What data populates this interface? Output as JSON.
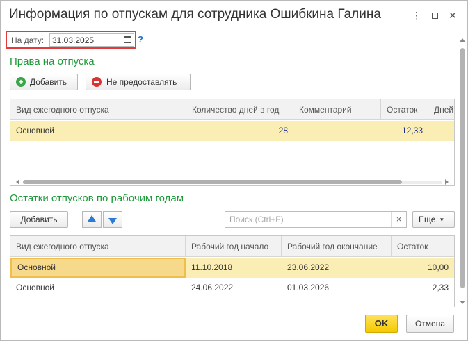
{
  "window": {
    "title": "Информация по отпускам для сотрудника Ошибкина Галина",
    "controls": {
      "more": "⋮",
      "minimize": "—",
      "close": "✕"
    }
  },
  "date_filter": {
    "label": "На дату:",
    "value": "31.03.2025",
    "help": "?"
  },
  "rights": {
    "section_title": "Права на отпуска",
    "add_label": "Добавить",
    "deny_label": "Не предоставлять",
    "columns": [
      "Вид ежегодного отпуска",
      "",
      "Количество дней в год",
      "Комментарий",
      "Остаток",
      "Дней"
    ],
    "rows": [
      {
        "type": "Основной",
        "extra": "",
        "days_per_year": "28",
        "comment": "",
        "remainder": "12,33",
        "days": ""
      }
    ]
  },
  "balances": {
    "section_title": "Остатки отпусков по рабочим годам",
    "add_label": "Добавить",
    "search_placeholder": "Поиск (Ctrl+F)",
    "search_clear": "×",
    "more_label": "Еще",
    "columns": [
      "Вид ежегодного отпуска",
      "Рабочий год начало",
      "Рабочий год окончание",
      "Остаток"
    ],
    "rows": [
      {
        "type": "Основной",
        "start": "11.10.2018",
        "end": "23.06.2022",
        "remainder": "10,00"
      },
      {
        "type": "Основной",
        "start": "24.06.2022",
        "end": "01.03.2026",
        "remainder": "2,33"
      }
    ]
  },
  "footer": {
    "ok_label": "OK",
    "cancel_label": "Отмена"
  },
  "colors": {
    "accent_green": "#1e9a3a",
    "selected_row": "#fbeeb4",
    "ok_yellow": "#f5c900",
    "highlight_red": "#e23b3b"
  }
}
